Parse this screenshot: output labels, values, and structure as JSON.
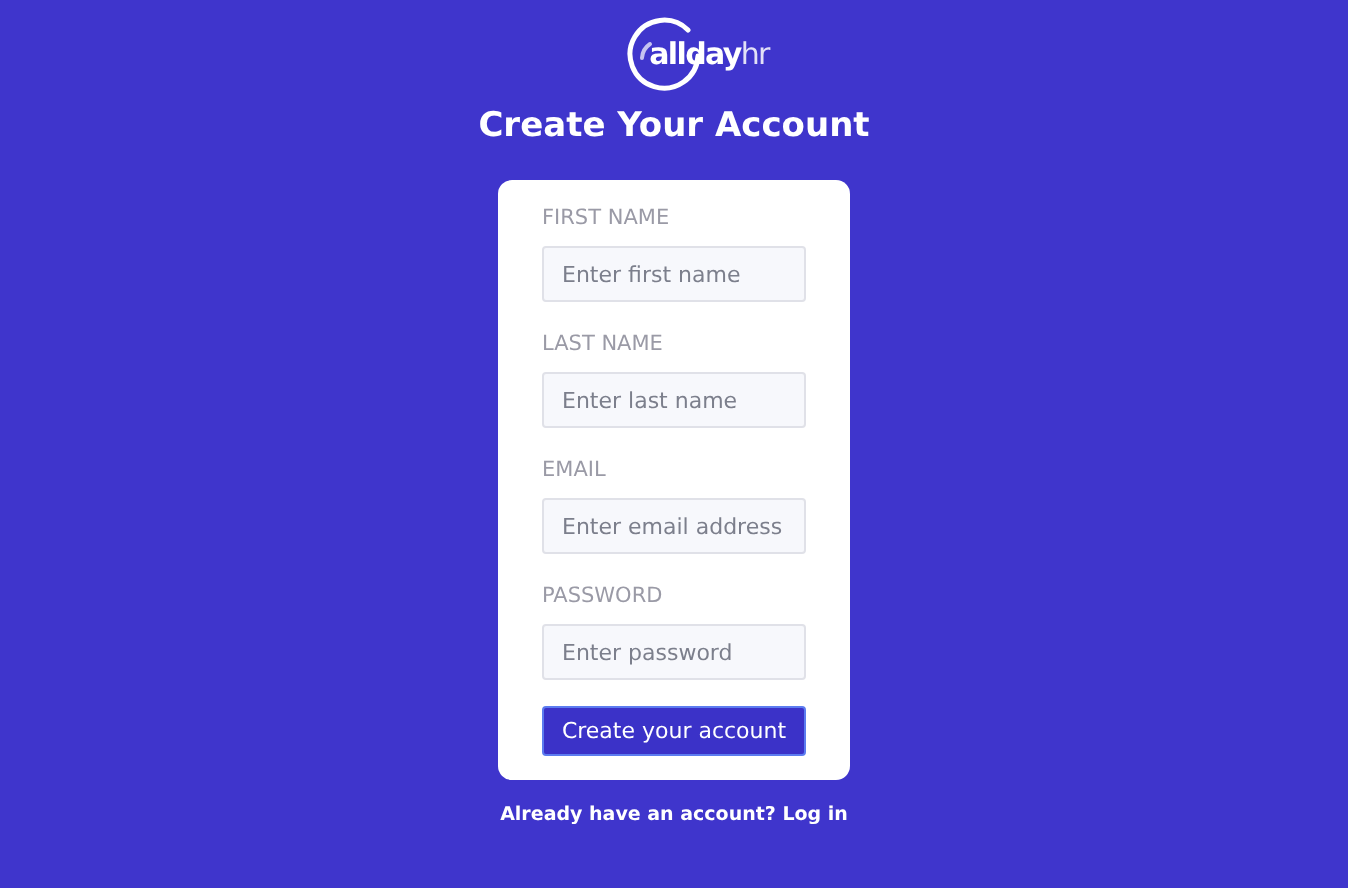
{
  "logo": {
    "name": "allday",
    "suffix": "hr"
  },
  "title": "Create Your Account",
  "fields": [
    {
      "label": "FIRST NAME",
      "placeholder": "Enter first name"
    },
    {
      "label": "LAST NAME",
      "placeholder": "Enter last name"
    },
    {
      "label": "EMAIL",
      "placeholder": "Enter email address"
    },
    {
      "label": "PASSWORD",
      "placeholder": "Enter password"
    }
  ],
  "submit": "Create your account",
  "login_link": "Already have an account? Log in"
}
